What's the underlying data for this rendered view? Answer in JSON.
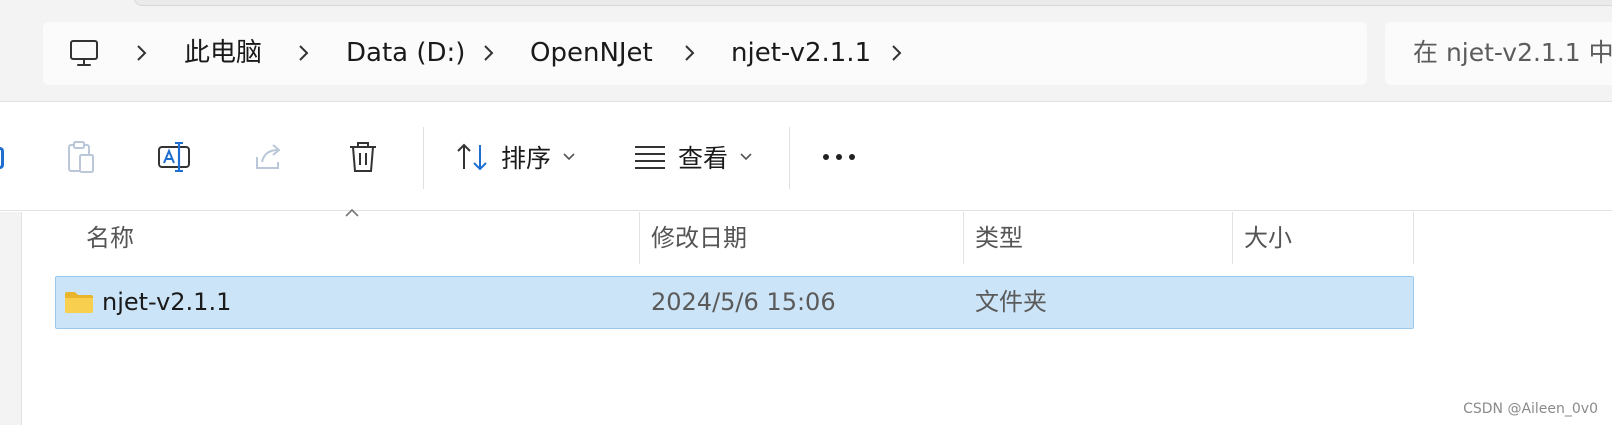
{
  "breadcrumb": {
    "items": [
      "此电脑",
      "Data (D:)",
      "OpenNJet",
      "njet-v2.1.1"
    ]
  },
  "search": {
    "placeholder": "在 njet-v2.1.1 中"
  },
  "toolbar": {
    "sort_label": "排序",
    "view_label": "查看",
    "icons": [
      "paste-icon",
      "rename-icon",
      "share-icon",
      "delete-icon",
      "sort-icon",
      "view-icon",
      "more-icon"
    ]
  },
  "columns": {
    "name": "名称",
    "modified": "修改日期",
    "type": "类型",
    "size": "大小"
  },
  "files": [
    {
      "name": "njet-v2.1.1",
      "modified": "2024/5/6 15:06",
      "type": "文件夹",
      "size": ""
    }
  ],
  "watermark": "CSDN @Aileen_0v0",
  "colors": {
    "accent": "#1f6fd1",
    "selection_bg": "#cce4f7",
    "selection_border": "#99c9ef",
    "folder": "#f5c542"
  }
}
